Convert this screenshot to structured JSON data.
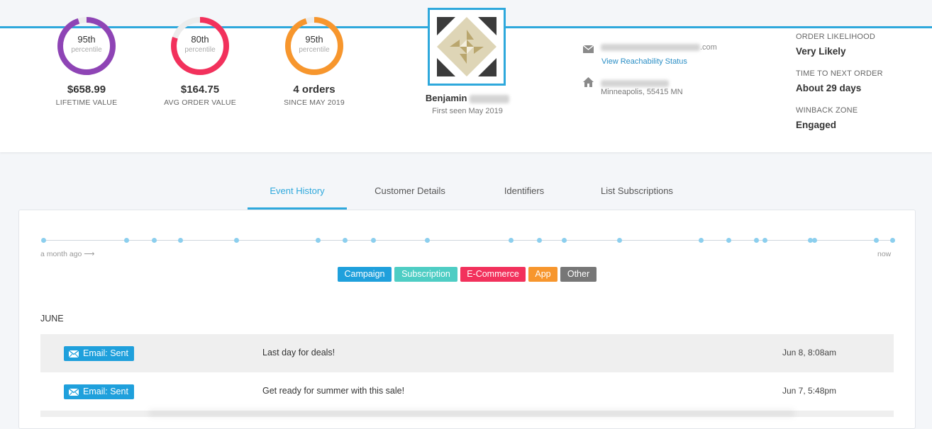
{
  "stats": [
    {
      "percentile": "95th",
      "percentile_sub": "percentile",
      "value": "$658.99",
      "label": "LIFETIME VALUE",
      "color": "#8e44b5",
      "fill": 0.95
    },
    {
      "percentile": "80th",
      "percentile_sub": "percentile",
      "value": "$164.75",
      "label": "AVG ORDER VALUE",
      "color": "#f2315c",
      "fill": 0.8
    },
    {
      "percentile": "95th",
      "percentile_sub": "percentile",
      "value": "4 orders",
      "label": "SINCE MAY 2019",
      "color": "#f7962d",
      "fill": 0.95
    }
  ],
  "profile": {
    "first_name": "Benjamin",
    "first_seen": "First seen May 2019",
    "email_suffix": ".com",
    "reachability_link": "View Reachability Status",
    "city": "Minneapolis, 55415 MN"
  },
  "metrics": [
    {
      "label": "ORDER LIKELIHOOD",
      "value": "Very Likely"
    },
    {
      "label": "TIME TO NEXT ORDER",
      "value": "About 29 days"
    },
    {
      "label": "WINBACK ZONE",
      "value": "Engaged"
    }
  ],
  "tabs": [
    {
      "label": "Event History",
      "active": true
    },
    {
      "label": "Customer Details",
      "active": false
    },
    {
      "label": "Identifiers",
      "active": false
    },
    {
      "label": "List Subscriptions",
      "active": false
    }
  ],
  "timeline": {
    "start_label": "a month ago ⟶",
    "end_label": "now"
  },
  "legend": [
    {
      "label": "Campaign",
      "color": "#1fa0dc"
    },
    {
      "label": "Subscription",
      "color": "#4ecdc4"
    },
    {
      "label": "E-Commerce",
      "color": "#f2315c"
    },
    {
      "label": "App",
      "color": "#f7962d"
    },
    {
      "label": "Other",
      "color": "#777777"
    }
  ],
  "events": {
    "month": "JUNE",
    "rows": [
      {
        "type": "Email: Sent",
        "title": "Last day for deals!",
        "date": "Jun 8, 8:08am"
      },
      {
        "type": "Email: Sent",
        "title": "Get ready for summer with this sale!",
        "date": "Jun 7, 5:48pm"
      }
    ]
  },
  "icons": {
    "email": "envelope-icon",
    "address": "home-icon",
    "avatar": "geometric-avatar-icon"
  }
}
